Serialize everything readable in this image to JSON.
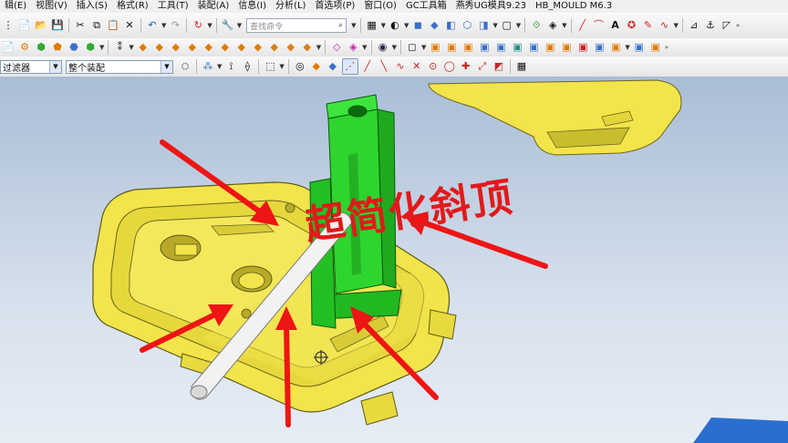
{
  "menu": [
    "辑(E)",
    "视图(V)",
    "插入(S)",
    "格式(R)",
    "工具(T)",
    "装配(A)",
    "信息(I)",
    "分析(L)",
    "首选项(P)",
    "窗口(O)",
    "GC工具箱",
    "燕秀UG模具9.23",
    "HB_MOULD M6.3"
  ],
  "search": {
    "placeholder": "查找命令"
  },
  "selection": {
    "filter": "过滤器",
    "scope": "整个装配"
  },
  "overlay": {
    "title": "超简化斜顶"
  },
  "colors": {
    "part": "#f2e44a",
    "lifter": "#2ed52e",
    "rod": "#f2f2f2",
    "arrow": "#ee1515",
    "text": "#e11a1a"
  },
  "icons": {
    "toolbar1": [
      "new-icon",
      "open-icon",
      "save-icon",
      "cut-icon",
      "copy-icon",
      "paste-icon",
      "delete-icon",
      "undo-icon",
      "redo-icon",
      "repeat-icon",
      "wrench-icon"
    ],
    "toolbar_right": [
      "snap-view-icon",
      "display-mode-icon",
      "box-icon",
      "line-icon",
      "curve-icon",
      "text-a-icon",
      "shape-icon",
      "sketch-icon"
    ]
  }
}
